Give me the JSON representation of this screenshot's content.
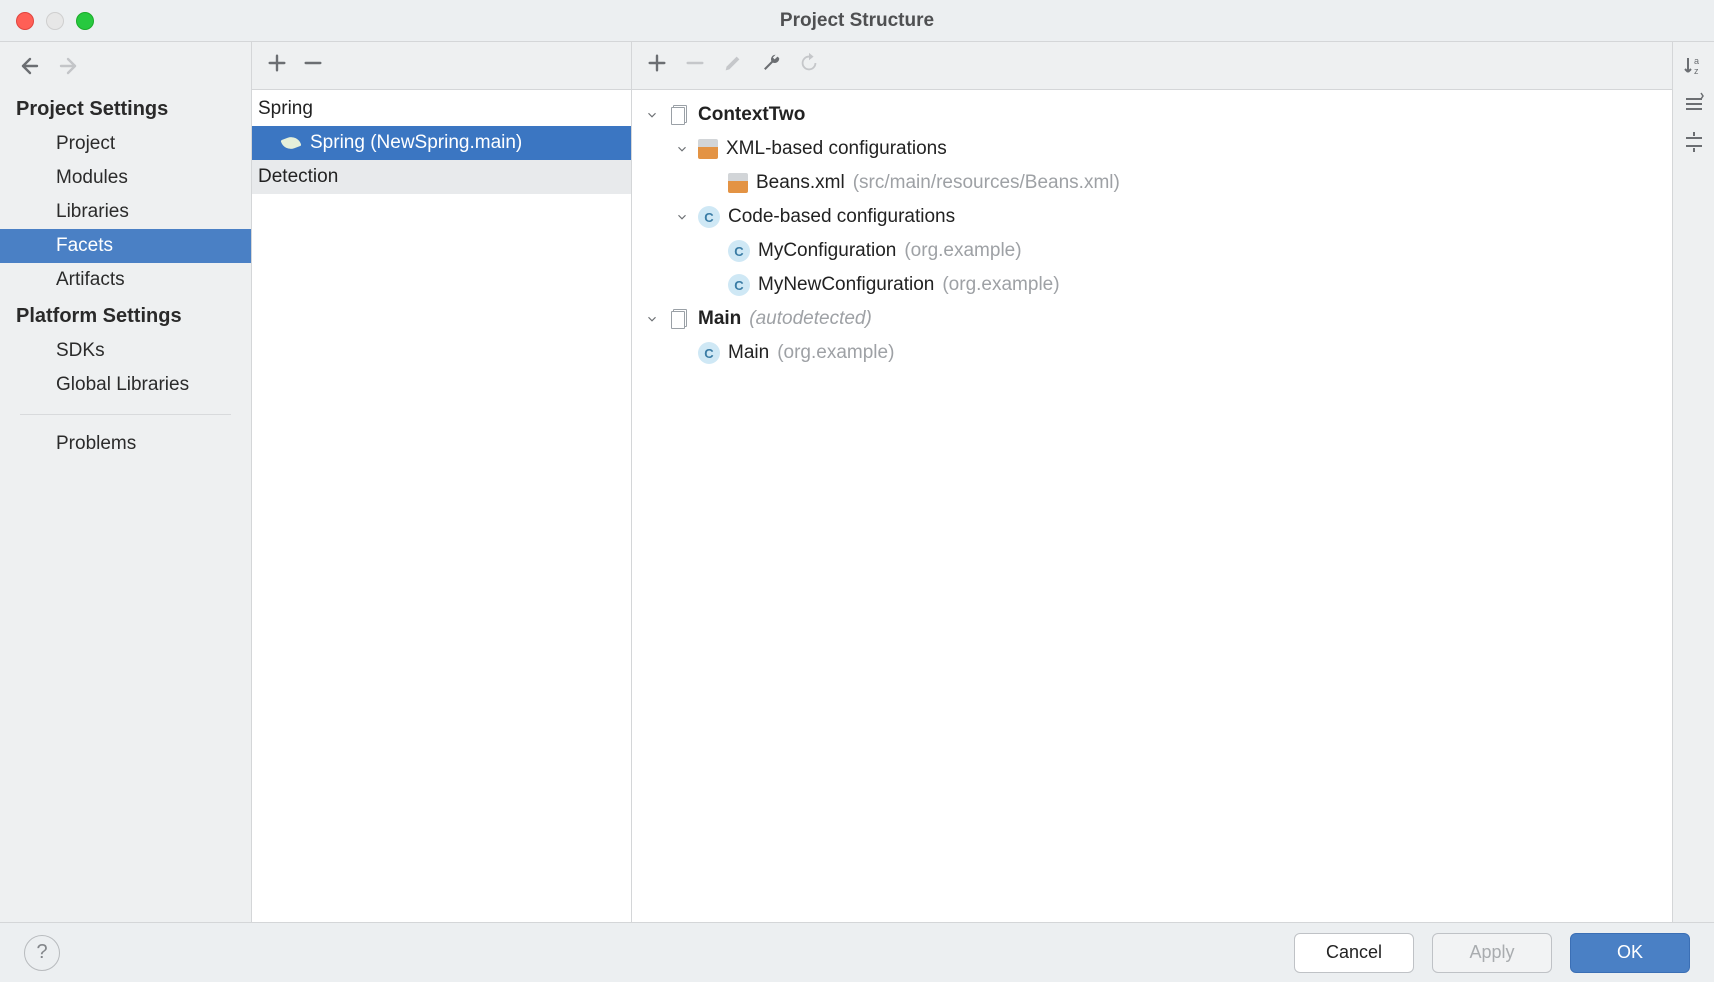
{
  "window": {
    "title": "Project Structure"
  },
  "sidebar": {
    "sections": [
      {
        "title": "Project Settings",
        "items": [
          "Project",
          "Modules",
          "Libraries",
          "Facets",
          "Artifacts"
        ],
        "selected": "Facets"
      },
      {
        "title": "Platform Settings",
        "items": [
          "SDKs",
          "Global Libraries"
        ]
      }
    ],
    "extra": [
      "Problems"
    ]
  },
  "facets": {
    "root": "Spring",
    "child": "Spring (NewSpring.main)",
    "detection": "Detection"
  },
  "tree": {
    "context": {
      "name": "ContextTwo"
    },
    "xml": {
      "label": "XML-based configurations",
      "file": {
        "name": "Beans.xml",
        "path": "(src/main/resources/Beans.xml)"
      }
    },
    "code": {
      "label": "Code-based configurations",
      "items": [
        {
          "name": "MyConfiguration",
          "pkg": "(org.example)"
        },
        {
          "name": "MyNewConfiguration",
          "pkg": "(org.example)"
        }
      ]
    },
    "main": {
      "name": "Main",
      "tag": "(autodetected)",
      "items": [
        {
          "name": "Main",
          "pkg": "(org.example)"
        }
      ]
    }
  },
  "footer": {
    "cancel": "Cancel",
    "apply": "Apply",
    "ok": "OK"
  }
}
